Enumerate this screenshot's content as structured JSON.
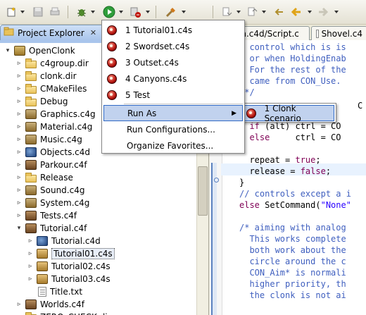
{
  "toolbar": {
    "icons": [
      "new-wizard-icon",
      "save-icon",
      "print-icon",
      "debug-icon",
      "run-icon",
      "external-tools-icon",
      "tools-icon",
      "next-annotation-icon",
      "prev-annotation-icon",
      "last-edit-icon",
      "back-icon",
      "forward-icon"
    ]
  },
  "project_explorer": {
    "title": "Project Explorer",
    "close": "✕",
    "items": [
      {
        "label": "OpenClonk",
        "type": "proj",
        "level": 0,
        "expanded": true
      },
      {
        "label": "c4group.dir",
        "type": "folder",
        "level": 1,
        "expanded": false
      },
      {
        "label": "clonk.dir",
        "type": "folder",
        "level": 1,
        "expanded": false
      },
      {
        "label": "CMakeFiles",
        "type": "folder",
        "level": 1,
        "expanded": false
      },
      {
        "label": "Debug",
        "type": "folder",
        "level": 1,
        "expanded": false
      },
      {
        "label": "Graphics.c4g",
        "type": "c4g",
        "level": 1,
        "expanded": false
      },
      {
        "label": "Material.c4g",
        "type": "c4g",
        "level": 1,
        "expanded": false
      },
      {
        "label": "Music.c4g",
        "type": "c4g",
        "level": 1,
        "expanded": false
      },
      {
        "label": "Objects.c4d",
        "type": "c4d",
        "level": 1,
        "expanded": false
      },
      {
        "label": "Parkour.c4f",
        "type": "c4f",
        "level": 1,
        "expanded": false
      },
      {
        "label": "Release",
        "type": "folder",
        "level": 1,
        "expanded": false
      },
      {
        "label": "Sound.c4g",
        "type": "c4g",
        "level": 1,
        "expanded": false
      },
      {
        "label": "System.c4g",
        "type": "c4g",
        "level": 1,
        "expanded": false
      },
      {
        "label": "Tests.c4f",
        "type": "c4f",
        "level": 1,
        "expanded": false
      },
      {
        "label": "Tutorial.c4f",
        "type": "c4f",
        "level": 1,
        "expanded": true
      },
      {
        "label": "Tutorial.c4d",
        "type": "c4d",
        "level": 2,
        "expanded": false
      },
      {
        "label": "Tutorial01.c4s",
        "type": "c4s",
        "level": 2,
        "expanded": false,
        "selected": true
      },
      {
        "label": "Tutorial02.c4s",
        "type": "c4s",
        "level": 2,
        "expanded": false
      },
      {
        "label": "Tutorial03.c4s",
        "type": "c4s",
        "level": 2,
        "expanded": false
      },
      {
        "label": "Title.txt",
        "type": "txt",
        "level": 2,
        "leaf": true
      },
      {
        "label": "Worlds.c4f",
        "type": "c4f",
        "level": 1,
        "expanded": false
      },
      {
        "label": "ZERO_CHECK.dir",
        "type": "folder",
        "level": 1,
        "expanded": false
      }
    ]
  },
  "editor": {
    "tabs": [
      {
        "label": "on.c4d/Script.c"
      },
      {
        "label": "Shovel.c4",
        "close": "✕"
      }
    ],
    "lines": [
      {
        "parts": [
          {
            "t": "  control which is is",
            "c": "cm"
          }
        ]
      },
      {
        "parts": [
          {
            "t": "  or when HoldingEnab",
            "c": "cm"
          }
        ]
      },
      {
        "parts": [
          {
            "t": "  For the rest of the",
            "c": "cm"
          }
        ]
      },
      {
        "parts": [
          {
            "t": "  came from CON_Use.",
            "c": "cm"
          }
        ]
      },
      {
        "parts": [
          {
            "t": " */",
            "c": "cm"
          }
        ]
      },
      {
        "parts": [
          {
            "t": "",
            "c": "plain"
          }
        ]
      },
      {
        "parts": [
          {
            "t": "",
            "c": "plain"
          }
        ]
      },
      {
        "parts": [
          {
            "t": "  if",
            "c": "kw"
          },
          {
            "t": " (alt) ctrl = CO",
            "c": "plain"
          }
        ]
      },
      {
        "parts": [
          {
            "t": "  else",
            "c": "kw"
          },
          {
            "t": "     ctrl = CO",
            "c": "plain"
          }
        ]
      },
      {
        "parts": [
          {
            "t": "",
            "c": "plain"
          }
        ]
      },
      {
        "parts": [
          {
            "t": "  repeat = ",
            "c": "plain"
          },
          {
            "t": "true",
            "c": "kw"
          },
          {
            "t": ";",
            "c": "plain"
          }
        ]
      },
      {
        "parts": [
          {
            "t": "  release = ",
            "c": "plain"
          },
          {
            "t": "false",
            "c": "kw"
          },
          {
            "t": ";",
            "c": "plain"
          }
        ]
      },
      {
        "parts": [
          {
            "t": "}",
            "c": "plain"
          }
        ]
      },
      {
        "parts": [
          {
            "t": "// controls except a i",
            "c": "cm"
          }
        ]
      },
      {
        "parts": [
          {
            "t": "else",
            "c": "kw"
          },
          {
            "t": " SetCommand(",
            "c": "plain"
          },
          {
            "t": "\"None\"",
            "c": "str"
          }
        ]
      },
      {
        "parts": [
          {
            "t": "",
            "c": "plain"
          }
        ]
      },
      {
        "parts": [
          {
            "t": "/* aiming with analog",
            "c": "cm"
          }
        ]
      },
      {
        "parts": [
          {
            "t": "  This works complete",
            "c": "cm"
          }
        ]
      },
      {
        "parts": [
          {
            "t": "  both work about the",
            "c": "cm"
          }
        ]
      },
      {
        "parts": [
          {
            "t": "  circle around the c",
            "c": "cm"
          }
        ]
      },
      {
        "parts": [
          {
            "t": "  CON_Aim* is normali",
            "c": "cm"
          }
        ]
      },
      {
        "parts": [
          {
            "t": "  higher priority, th",
            "c": "cm"
          }
        ]
      },
      {
        "parts": [
          {
            "t": "  the clonk is not ai",
            "c": "cm"
          }
        ]
      }
    ],
    "right_fragment": "C"
  },
  "run_menu": {
    "items": [
      {
        "label": "1 Tutorial01.c4s",
        "icon": "clonk-scenario-icon"
      },
      {
        "label": "2 Swordset.c4s",
        "icon": "clonk-scenario-icon"
      },
      {
        "label": "3 Outset.c4s",
        "icon": "clonk-scenario-icon"
      },
      {
        "label": "4 Canyons.c4s",
        "icon": "clonk-scenario-icon"
      },
      {
        "label": "5 Test",
        "icon": "clonk-scenario-icon"
      },
      {
        "label": "Run As",
        "submenu": true
      },
      {
        "label": "Run Configurations..."
      },
      {
        "label": "Organize Favorites..."
      }
    ],
    "submenu_items": [
      {
        "label": "1 Clonk Scenario",
        "icon": "clonk-scenario-icon"
      }
    ]
  },
  "colors": {
    "comment": "#3f5fbf",
    "keyword": "#7f0055",
    "string": "#2a00ff",
    "menu_highlight": "#c1d2ee"
  }
}
